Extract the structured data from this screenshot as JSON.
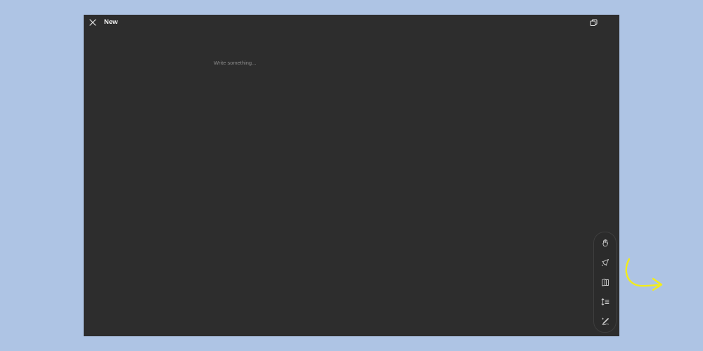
{
  "window": {
    "title": "New",
    "background": "#2d2d2d"
  },
  "header": {
    "close_icon": "close-icon",
    "restore_icon": "restore-window-icon"
  },
  "editor": {
    "placeholder": "Write something..."
  },
  "toolbar": {
    "tools": [
      {
        "icon": "hand-stop-icon"
      },
      {
        "icon": "rocket-icon"
      },
      {
        "icon": "book-icon"
      },
      {
        "icon": "line-spacing-icon"
      },
      {
        "icon": "pen-sparkle-icon"
      }
    ]
  },
  "annotation": {
    "color": "#f2ec1c"
  }
}
